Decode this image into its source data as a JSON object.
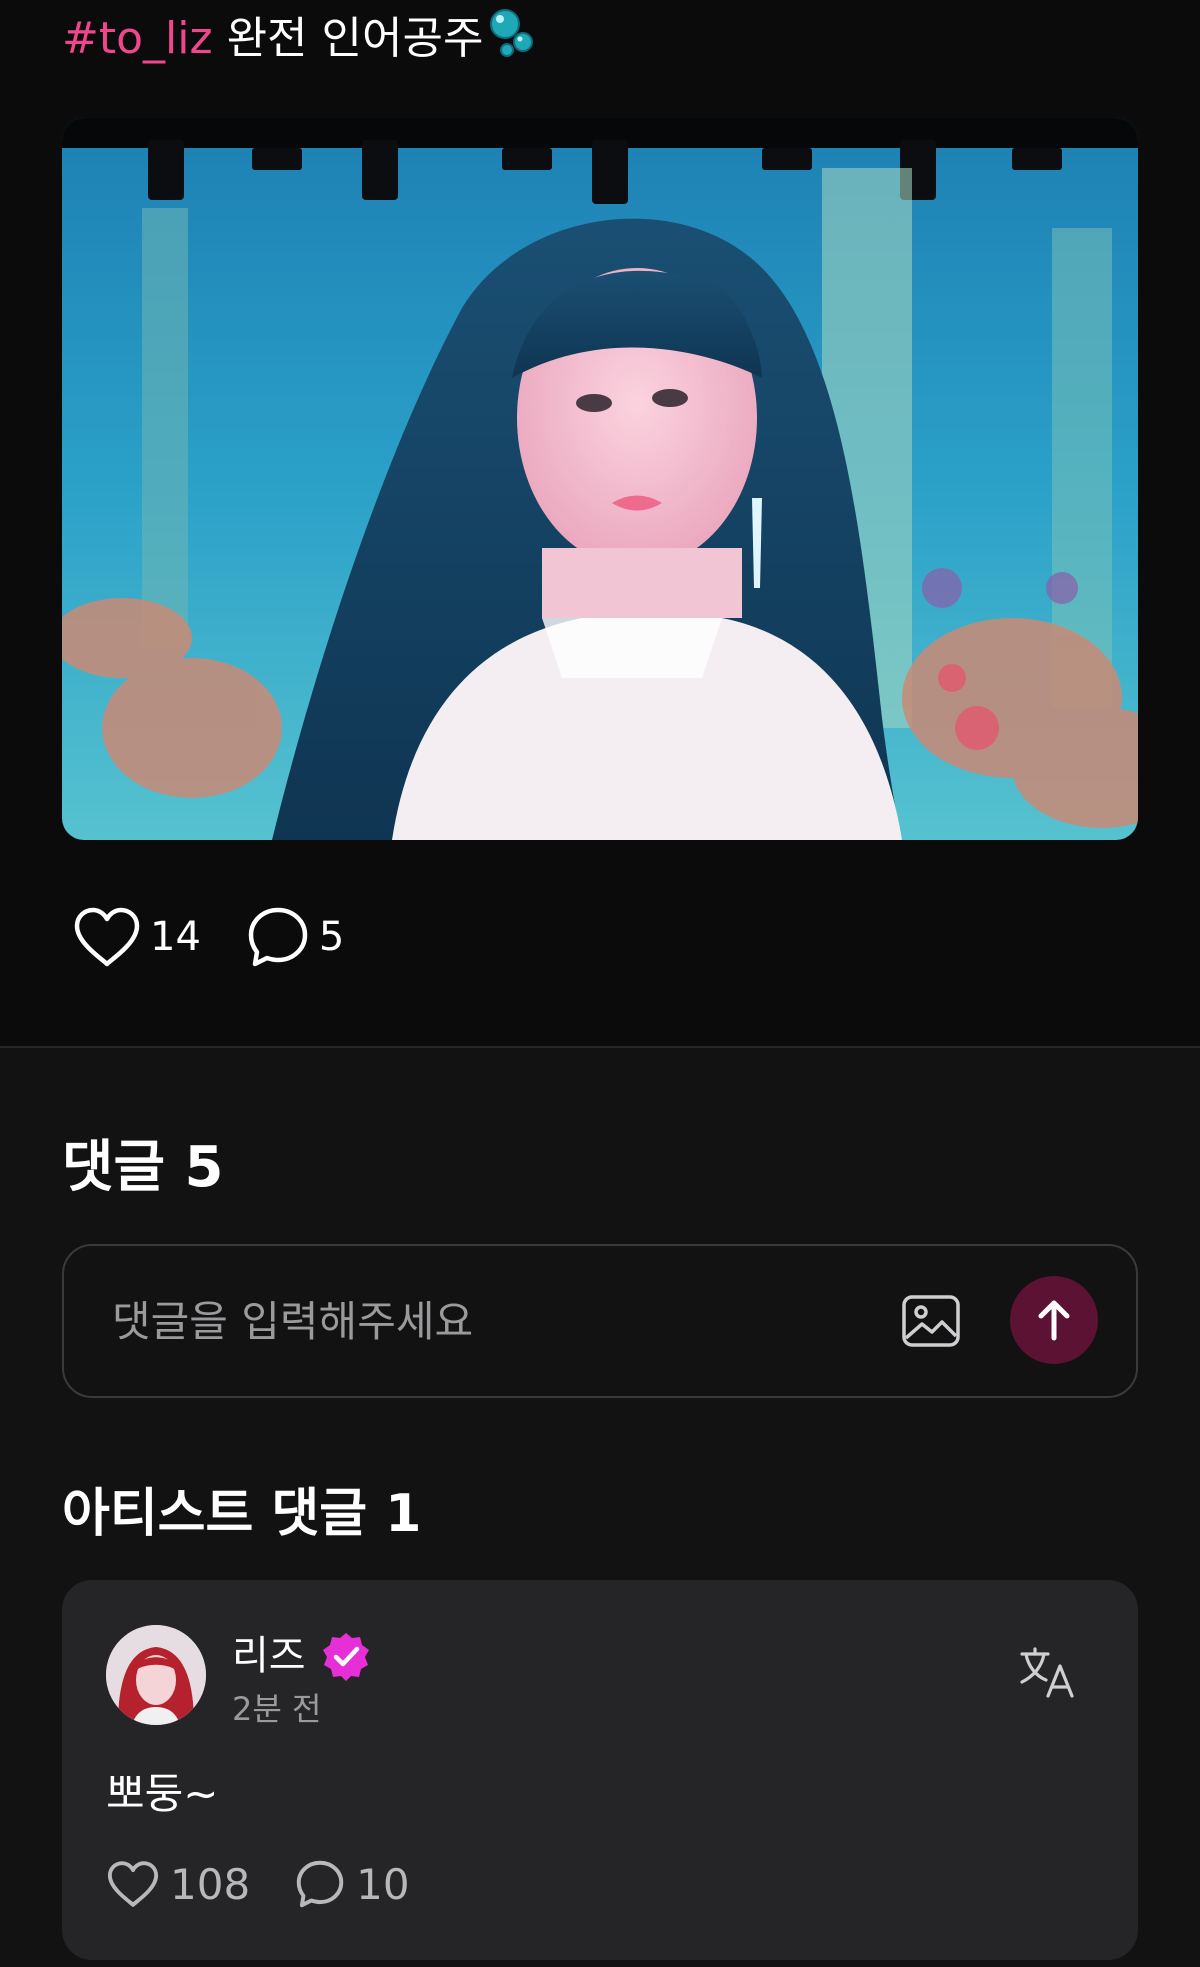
{
  "post": {
    "hashtag": "#to_liz",
    "caption": " 완전 인어공주",
    "emoji": "bubbles",
    "likes": "14",
    "comments": "5",
    "icons": {
      "like": "heart-icon",
      "comment": "comment-bubble-icon"
    }
  },
  "comments_section": {
    "title": "댓글 5",
    "input_placeholder": "댓글을 입력해주세요",
    "input_value": "",
    "icons": {
      "attach": "image-icon",
      "send": "arrow-up-icon"
    }
  },
  "artist_comments": {
    "title": "아티스트 댓글 1",
    "items": [
      {
        "author": "리즈",
        "verified": true,
        "time": "2분 전",
        "text": "뽀둥~",
        "likes": "108",
        "replies": "10"
      }
    ]
  },
  "colors": {
    "accent": "#f0468c",
    "send_button": "#5c1232",
    "verified_badge": "#e62fd6",
    "card_bg": "#252527",
    "page_bg": "#121212"
  }
}
